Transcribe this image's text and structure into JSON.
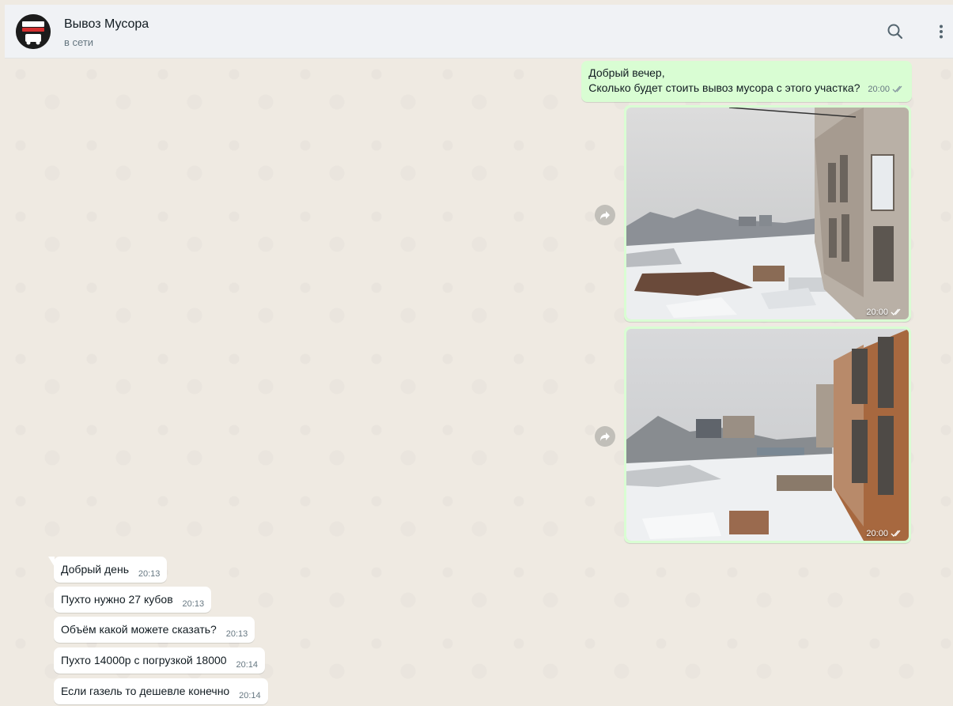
{
  "header": {
    "contact_name": "Вывоз Мусора",
    "status": "в сети",
    "icons": [
      "avatar",
      "search-icon",
      "menu-icon"
    ]
  },
  "messages": {
    "outgoing": {
      "text_line1": "Добрый вечер,",
      "text_line2": "Сколько будет стоить вывоз мусора с этого участка?",
      "time": "20:00"
    },
    "photos": [
      {
        "time": "20:00"
      },
      {
        "time": "20:00"
      }
    ],
    "incoming": [
      {
        "text": "Добрый день",
        "time": "20:13"
      },
      {
        "text": "Пухто нужно 27 кубов",
        "time": "20:13"
      },
      {
        "text": "Объём какой можете сказать?",
        "time": "20:13"
      },
      {
        "text": "Пухто 14000р с погрузкой 18000",
        "time": "20:14"
      },
      {
        "text": "Если газель то дешевле конечно",
        "time": "20:14"
      }
    ]
  },
  "colors": {
    "outgoing_bubble": "#d9fdd3",
    "incoming_bubble": "#ffffff",
    "chat_background": "#efeae2",
    "header_background": "#f0f2f5",
    "read_tick": "#53bdeb"
  }
}
